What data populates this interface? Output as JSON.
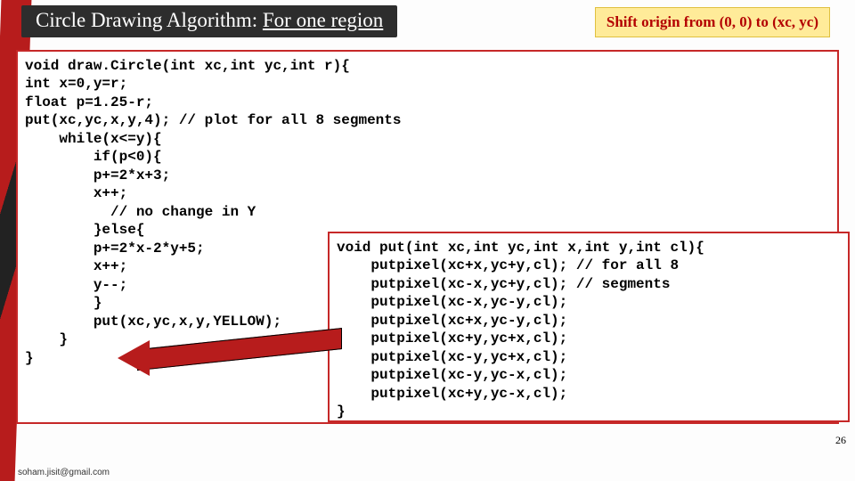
{
  "title": {
    "a": "Circle Drawing Algorithm: ",
    "b": "For one region"
  },
  "tag": "Shift origin from (0, 0) to (xc, yc)",
  "code_main": "void draw.Circle(int xc,int yc,int r){\nint x=0,y=r;\nfloat p=1.25-r;\nput(xc,yc,x,y,4); // plot for all 8 segments\n    while(x<=y){\n        if(p<0){\n        p+=2*x+3;\n        x++;\n          // no change in Y\n        }else{\n        p+=2*x-2*y+5;\n        x++;\n        y--;\n        }\n        put(xc,yc,x,y,YELLOW);\n    }\n}",
  "code_sub": "void put(int xc,int yc,int x,int y,int cl){\n    putpixel(xc+x,yc+y,cl); // for all 8\n    putpixel(xc-x,yc+y,cl); // segments\n    putpixel(xc-x,yc-y,cl);\n    putpixel(xc+x,yc-y,cl);\n    putpixel(xc+y,yc+x,cl);\n    putpixel(xc-y,yc+x,cl);\n    putpixel(xc-y,yc-x,cl);\n    putpixel(xc+y,yc-x,cl);\n}",
  "page_num": "26",
  "footer": "soham.jisit@gmail.com"
}
